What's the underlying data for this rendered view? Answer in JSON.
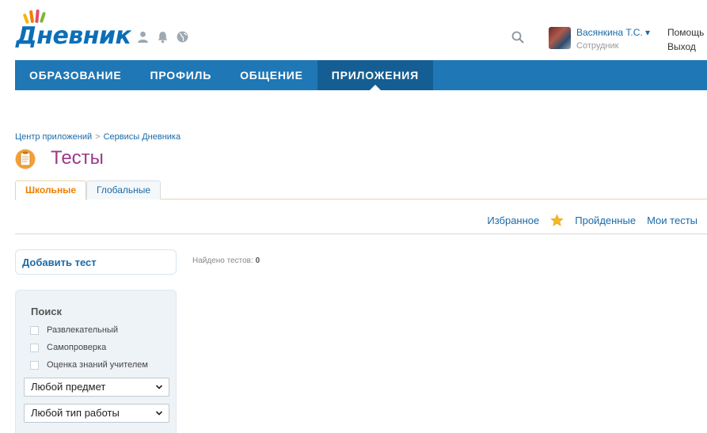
{
  "header": {
    "logo_text": "Дневник",
    "user_name": "Васянкина Т.С. ▾",
    "user_role": "Сотрудник",
    "help": "Помощь",
    "logout": "Выход",
    "icons": [
      "user-icon",
      "bell-icon",
      "globe-icon",
      "search-icon"
    ]
  },
  "nav": {
    "items": [
      {
        "label": "ОБРАЗОВАНИЕ"
      },
      {
        "label": "ПРОФИЛЬ"
      },
      {
        "label": "ОБЩЕНИЕ"
      },
      {
        "label": "ПРИЛОЖЕНИЯ",
        "active": true
      }
    ]
  },
  "breadcrumb": {
    "items": [
      "Центр приложений",
      "Сервисы Дневника"
    ],
    "separator": ">"
  },
  "page": {
    "title": "Тесты"
  },
  "tabs": [
    {
      "label": "Школьные",
      "active": true
    },
    {
      "label": "Глобальные",
      "active": false
    }
  ],
  "links": {
    "favorites": "Избранное",
    "completed": "Пройденные",
    "my_tests": "Мои тесты"
  },
  "actions": {
    "add_test": "Добавить тест",
    "found_label": "Найдено тестов:",
    "found_count": "0"
  },
  "search": {
    "title": "Поиск",
    "checkboxes": [
      {
        "label": "Развлекательный",
        "checked": false
      },
      {
        "label": "Самопроверка",
        "checked": false
      },
      {
        "label": "Оценка знаний учителем",
        "checked": false
      }
    ],
    "subject_select": "Любой предмет",
    "worktype_select": "Любой тип работы"
  },
  "colors": {
    "nav_bg": "#1f77b5",
    "nav_active": "#155e93",
    "link": "#1a6aa8",
    "title": "#9b3a8a",
    "tab_active": "#f07d00"
  }
}
